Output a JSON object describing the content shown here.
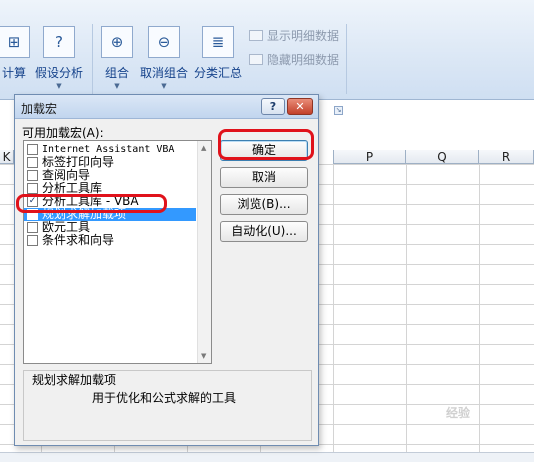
{
  "ribbon": {
    "calc_label": "计算",
    "whatif_label": "假设分析",
    "group_label": "组合",
    "ungroup_label": "取消组合",
    "subtotal_label": "分类汇总",
    "show_detail_label": "显示明细数据",
    "hide_detail_label": "隐藏明细数据"
  },
  "sheet": {
    "col_k": "K",
    "col_p": "P",
    "col_q": "Q",
    "col_r": "R"
  },
  "dialog": {
    "title": "加载宏",
    "help_label": "?",
    "close_label": "✕",
    "list_label": "可用加载宏(A):",
    "items": [
      {
        "label": "Internet Assistant VBA",
        "checked": false
      },
      {
        "label": "标签打印向导",
        "checked": false
      },
      {
        "label": "查阅向导",
        "checked": false
      },
      {
        "label": "分析工具库",
        "checked": false
      },
      {
        "label": "分析工具库 - VBA",
        "checked": true
      },
      {
        "label": "规划求解加载项",
        "checked": false,
        "selected": true
      },
      {
        "label": "欧元工具",
        "checked": false
      },
      {
        "label": "条件求和向导",
        "checked": false
      }
    ],
    "ok_label": "确定",
    "cancel_label": "取消",
    "browse_label": "浏览(B)...",
    "automation_label": "自动化(U)...",
    "description_title": "规划求解加载项",
    "description_text": "用于优化和公式求解的工具"
  },
  "watermark": "经验"
}
